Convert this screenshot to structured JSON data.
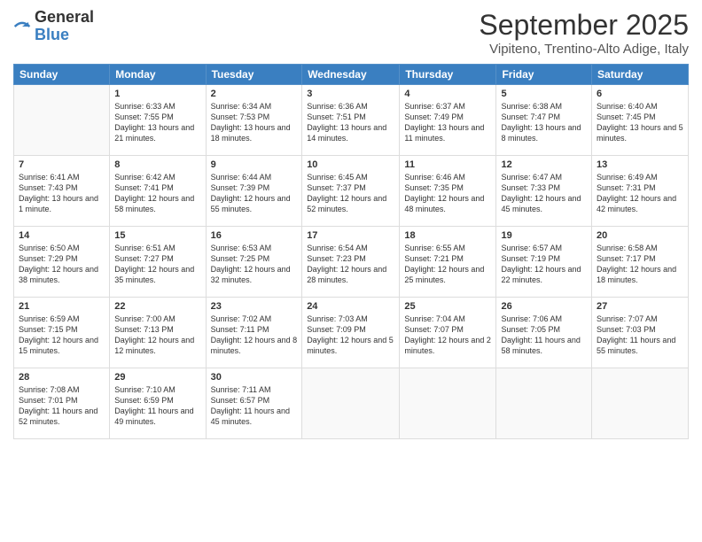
{
  "logo": {
    "general": "General",
    "blue": "Blue"
  },
  "header": {
    "month": "September 2025",
    "location": "Vipiteno, Trentino-Alto Adige, Italy"
  },
  "weekdays": [
    "Sunday",
    "Monday",
    "Tuesday",
    "Wednesday",
    "Thursday",
    "Friday",
    "Saturday"
  ],
  "weeks": [
    [
      {
        "day": "",
        "info": ""
      },
      {
        "day": "1",
        "info": "Sunrise: 6:33 AM\nSunset: 7:55 PM\nDaylight: 13 hours and 21 minutes."
      },
      {
        "day": "2",
        "info": "Sunrise: 6:34 AM\nSunset: 7:53 PM\nDaylight: 13 hours and 18 minutes."
      },
      {
        "day": "3",
        "info": "Sunrise: 6:36 AM\nSunset: 7:51 PM\nDaylight: 13 hours and 14 minutes."
      },
      {
        "day": "4",
        "info": "Sunrise: 6:37 AM\nSunset: 7:49 PM\nDaylight: 13 hours and 11 minutes."
      },
      {
        "day": "5",
        "info": "Sunrise: 6:38 AM\nSunset: 7:47 PM\nDaylight: 13 hours and 8 minutes."
      },
      {
        "day": "6",
        "info": "Sunrise: 6:40 AM\nSunset: 7:45 PM\nDaylight: 13 hours and 5 minutes."
      }
    ],
    [
      {
        "day": "7",
        "info": "Sunrise: 6:41 AM\nSunset: 7:43 PM\nDaylight: 13 hours and 1 minute."
      },
      {
        "day": "8",
        "info": "Sunrise: 6:42 AM\nSunset: 7:41 PM\nDaylight: 12 hours and 58 minutes."
      },
      {
        "day": "9",
        "info": "Sunrise: 6:44 AM\nSunset: 7:39 PM\nDaylight: 12 hours and 55 minutes."
      },
      {
        "day": "10",
        "info": "Sunrise: 6:45 AM\nSunset: 7:37 PM\nDaylight: 12 hours and 52 minutes."
      },
      {
        "day": "11",
        "info": "Sunrise: 6:46 AM\nSunset: 7:35 PM\nDaylight: 12 hours and 48 minutes."
      },
      {
        "day": "12",
        "info": "Sunrise: 6:47 AM\nSunset: 7:33 PM\nDaylight: 12 hours and 45 minutes."
      },
      {
        "day": "13",
        "info": "Sunrise: 6:49 AM\nSunset: 7:31 PM\nDaylight: 12 hours and 42 minutes."
      }
    ],
    [
      {
        "day": "14",
        "info": "Sunrise: 6:50 AM\nSunset: 7:29 PM\nDaylight: 12 hours and 38 minutes."
      },
      {
        "day": "15",
        "info": "Sunrise: 6:51 AM\nSunset: 7:27 PM\nDaylight: 12 hours and 35 minutes."
      },
      {
        "day": "16",
        "info": "Sunrise: 6:53 AM\nSunset: 7:25 PM\nDaylight: 12 hours and 32 minutes."
      },
      {
        "day": "17",
        "info": "Sunrise: 6:54 AM\nSunset: 7:23 PM\nDaylight: 12 hours and 28 minutes."
      },
      {
        "day": "18",
        "info": "Sunrise: 6:55 AM\nSunset: 7:21 PM\nDaylight: 12 hours and 25 minutes."
      },
      {
        "day": "19",
        "info": "Sunrise: 6:57 AM\nSunset: 7:19 PM\nDaylight: 12 hours and 22 minutes."
      },
      {
        "day": "20",
        "info": "Sunrise: 6:58 AM\nSunset: 7:17 PM\nDaylight: 12 hours and 18 minutes."
      }
    ],
    [
      {
        "day": "21",
        "info": "Sunrise: 6:59 AM\nSunset: 7:15 PM\nDaylight: 12 hours and 15 minutes."
      },
      {
        "day": "22",
        "info": "Sunrise: 7:00 AM\nSunset: 7:13 PM\nDaylight: 12 hours and 12 minutes."
      },
      {
        "day": "23",
        "info": "Sunrise: 7:02 AM\nSunset: 7:11 PM\nDaylight: 12 hours and 8 minutes."
      },
      {
        "day": "24",
        "info": "Sunrise: 7:03 AM\nSunset: 7:09 PM\nDaylight: 12 hours and 5 minutes."
      },
      {
        "day": "25",
        "info": "Sunrise: 7:04 AM\nSunset: 7:07 PM\nDaylight: 12 hours and 2 minutes."
      },
      {
        "day": "26",
        "info": "Sunrise: 7:06 AM\nSunset: 7:05 PM\nDaylight: 11 hours and 58 minutes."
      },
      {
        "day": "27",
        "info": "Sunrise: 7:07 AM\nSunset: 7:03 PM\nDaylight: 11 hours and 55 minutes."
      }
    ],
    [
      {
        "day": "28",
        "info": "Sunrise: 7:08 AM\nSunset: 7:01 PM\nDaylight: 11 hours and 52 minutes."
      },
      {
        "day": "29",
        "info": "Sunrise: 7:10 AM\nSunset: 6:59 PM\nDaylight: 11 hours and 49 minutes."
      },
      {
        "day": "30",
        "info": "Sunrise: 7:11 AM\nSunset: 6:57 PM\nDaylight: 11 hours and 45 minutes."
      },
      {
        "day": "",
        "info": ""
      },
      {
        "day": "",
        "info": ""
      },
      {
        "day": "",
        "info": ""
      },
      {
        "day": "",
        "info": ""
      }
    ]
  ]
}
